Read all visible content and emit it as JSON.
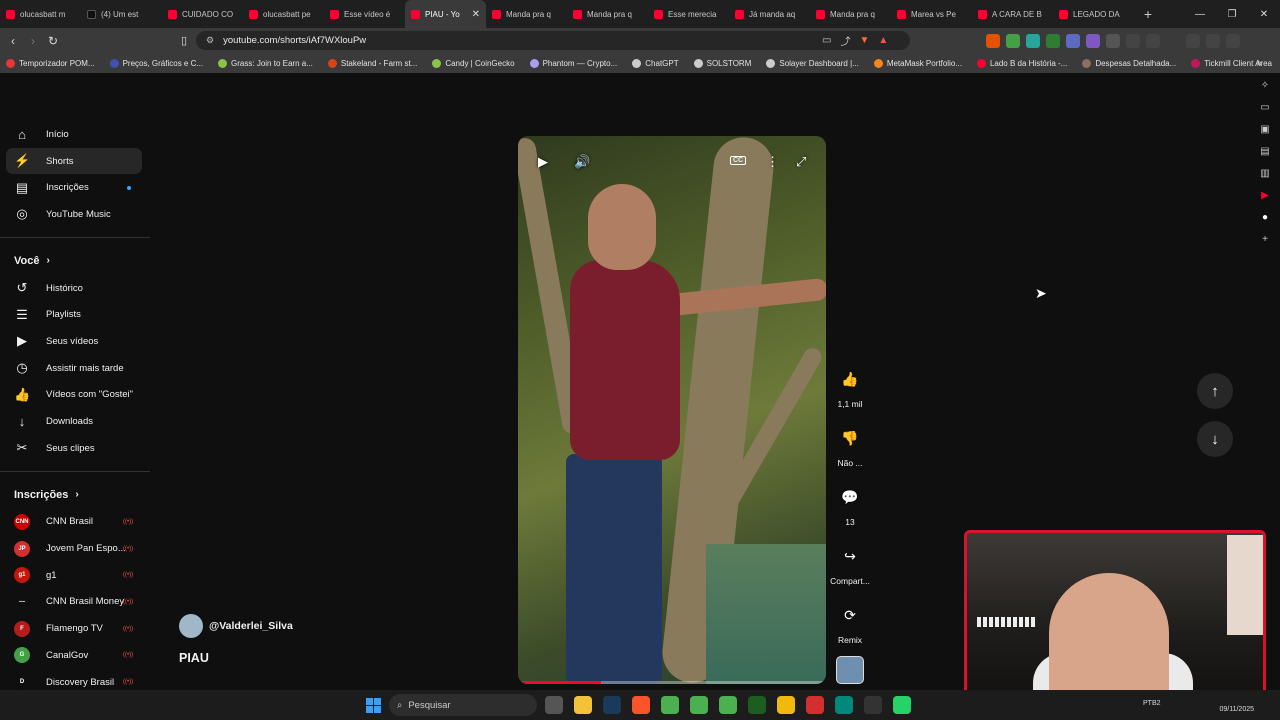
{
  "browser": {
    "tabs": [
      {
        "label": "olucasbatt m",
        "icon": "youtube",
        "active": false
      },
      {
        "label": "(4) Um est",
        "icon": "tiktok",
        "active": false
      },
      {
        "label": "CUIDADO CO",
        "icon": "youtube",
        "active": false
      },
      {
        "label": "olucasbatt pe",
        "icon": "youtube",
        "active": false
      },
      {
        "label": "Esse vídeo é",
        "icon": "youtube",
        "active": false
      },
      {
        "label": "PIAU - Yo",
        "icon": "youtube",
        "active": true
      },
      {
        "label": "Manda pra q",
        "icon": "youtube",
        "active": false
      },
      {
        "label": "Manda pra q",
        "icon": "youtube",
        "active": false
      },
      {
        "label": "Esse merecia",
        "icon": "youtube",
        "active": false
      },
      {
        "label": "Já manda aq",
        "icon": "youtube",
        "active": false
      },
      {
        "label": "Manda pra q",
        "icon": "youtube",
        "active": false
      },
      {
        "label": "Marea vs Pe",
        "icon": "youtube",
        "active": false
      },
      {
        "label": "A CARA DE B",
        "icon": "youtube",
        "active": false
      },
      {
        "label": "LEGADO DA",
        "icon": "youtube",
        "active": false
      }
    ],
    "url": "youtube.com/shorts/iAf7WXlouPw",
    "bookmarks": [
      {
        "label": "Temporizador POM...",
        "color": "#e53935"
      },
      {
        "label": "Preços, Gráficos e C...",
        "color": "#3f51b5"
      },
      {
        "label": "Grass: Join to Earn a...",
        "color": "#8bc34a"
      },
      {
        "label": "Stakeland - Farm st...",
        "color": "#d84315"
      },
      {
        "label": "Candy | CoinGecko",
        "color": "#8bc34a"
      },
      {
        "label": "Phantom — Crypto...",
        "color": "#ab9ff2"
      },
      {
        "label": "ChatGPT",
        "color": "#cccccc"
      },
      {
        "label": "SOLSTORM",
        "color": "#cccccc"
      },
      {
        "label": "Solayer Dashboard |...",
        "color": "#cccccc"
      },
      {
        "label": "MetaMask Portfolio...",
        "color": "#f6851b"
      },
      {
        "label": "Lado B da História -...",
        "color": "#ff0033"
      },
      {
        "label": "Despesas Detalhada...",
        "color": "#8d6e63"
      },
      {
        "label": "Tickmill Client Area",
        "color": "#c2185b"
      }
    ]
  },
  "sidebar": {
    "main": [
      {
        "label": "Início",
        "icon": "home-icon"
      },
      {
        "label": "Shorts",
        "icon": "shorts-icon"
      },
      {
        "label": "Inscrições",
        "icon": "subscriptions-icon"
      },
      {
        "label": "YouTube Music",
        "icon": "music-icon"
      }
    ],
    "you_heading": "Você",
    "you": [
      {
        "label": "Histórico",
        "icon": "history-icon"
      },
      {
        "label": "Playlists",
        "icon": "playlists-icon"
      },
      {
        "label": "Seus vídeos",
        "icon": "your-videos-icon"
      },
      {
        "label": "Assistir mais tarde",
        "icon": "watch-later-icon"
      },
      {
        "label": "Vídeos com \"Gostei\"",
        "icon": "liked-icon"
      },
      {
        "label": "Downloads",
        "icon": "downloads-icon"
      },
      {
        "label": "Seus clipes",
        "icon": "clips-icon"
      }
    ],
    "subs_heading": "Inscrições",
    "subs": [
      {
        "label": "CNN Brasil",
        "color": "#cc0000",
        "avatar_text": "CNN"
      },
      {
        "label": "Jovem Pan Espo...",
        "color": "#d32f2f",
        "avatar_text": "JP"
      },
      {
        "label": "g1",
        "color": "#c4170c",
        "avatar_text": "g1"
      },
      {
        "label": "CNN Brasil Money",
        "color": "#0f0f0f",
        "avatar_text": "—"
      },
      {
        "label": "Flamengo TV",
        "color": "#b71c1c",
        "avatar_text": "F"
      },
      {
        "label": "CanalGov",
        "color": "#43a047",
        "avatar_text": "G"
      },
      {
        "label": "Discovery Brasil",
        "color": "#0f0f0f",
        "avatar_text": "D"
      }
    ]
  },
  "short": {
    "channel": "@Valderlei_Silva",
    "title": "PIAU",
    "progress_fraction": 0.27,
    "actions": [
      {
        "label": "1,1 mil",
        "icon": "like-icon",
        "glyph": "👍"
      },
      {
        "label": "Não ...",
        "icon": "dislike-icon",
        "glyph": "👎"
      },
      {
        "label": "13",
        "icon": "comment-icon",
        "glyph": "💬"
      },
      {
        "label": "Compart...",
        "icon": "share-icon",
        "glyph": "↪"
      },
      {
        "label": "Remix",
        "icon": "remix-icon",
        "glyph": "⟳"
      }
    ],
    "cc_label": "CC"
  },
  "taskbar": {
    "search_placeholder": "Pesquisar",
    "lang": "PTB2",
    "date": "09/11/2025"
  }
}
